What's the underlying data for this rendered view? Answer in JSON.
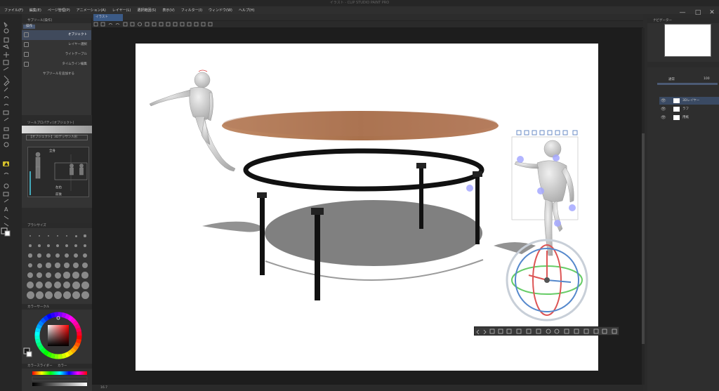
{
  "window": {
    "title": "イラスト - CLIP STUDIO PAINT PRO",
    "controls": [
      "—",
      "□",
      "✕"
    ]
  },
  "menu": [
    "ファイル(F)",
    "編集(E)",
    "ページ管理(P)",
    "アニメーション(A)",
    "レイヤー(L)",
    "選択範囲(S)",
    "表示(V)",
    "フィルター(I)",
    "ウィンドウ(W)",
    "ヘルプ(H)"
  ],
  "subtool_panel": {
    "header": "サブツール[操作]",
    "tab": "操作",
    "items": [
      {
        "label": "オブジェクト",
        "selected": true
      },
      {
        "label": "レイヤー選択",
        "selected": false
      },
      {
        "label": "ライトテーブル",
        "selected": false
      },
      {
        "label": "タイムライン編集",
        "selected": false
      }
    ],
    "add_label": "サブツールを追加する"
  },
  "tool_property": {
    "header": "ツールプロパティ[オブジェクト]",
    "combo": "【オブジェクト】3Dデッサン人形",
    "pose_label": "全身",
    "options": [
      "左右",
      "前後"
    ]
  },
  "brush_size": {
    "header": "ブラシサイズ"
  },
  "color": {
    "wheel_header": "カラーサークル",
    "slider_header": "カラースライダー",
    "tabs": [
      "カラースライダー",
      "カラー"
    ],
    "hue_color": "#ff0000",
    "main_color": "#1a1a1a",
    "sub_color": "#ffffff"
  },
  "canvas": {
    "tab": "イラスト",
    "zoom": "16.7",
    "paper_color": "#ffffff"
  },
  "navigator": {
    "header": "ナビゲーター"
  },
  "layers": {
    "blend_mode": "通常",
    "opacity": "100",
    "items": [
      {
        "name": "3Dレイヤー",
        "selected": true
      },
      {
        "name": "ラフ",
        "selected": false
      },
      {
        "name": "用紙",
        "selected": false
      }
    ]
  },
  "accent_color": "#d6c12c"
}
